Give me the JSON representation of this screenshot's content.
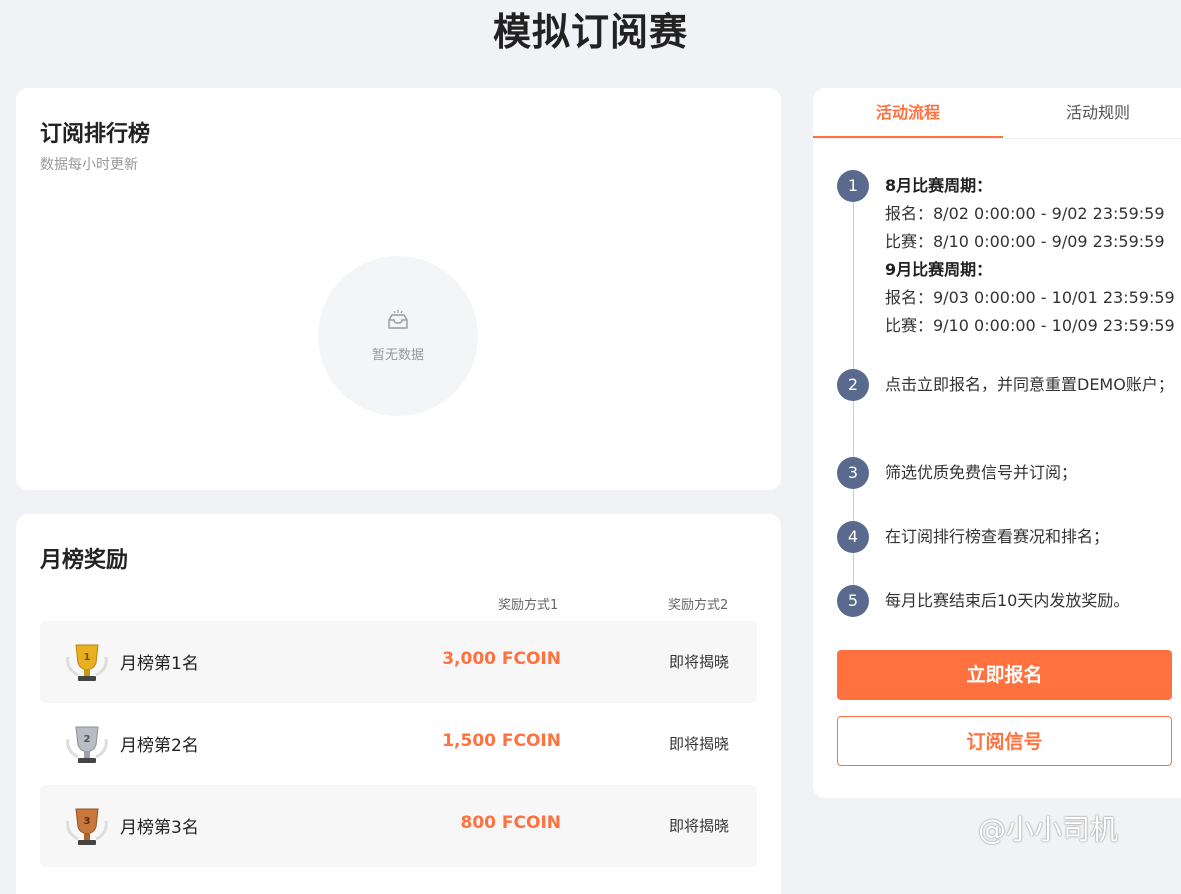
{
  "page": {
    "title": "模拟订阅赛"
  },
  "ranking": {
    "title": "订阅排行榜",
    "subtitle": "数据每小时更新",
    "empty_text": "暂无数据"
  },
  "rewards": {
    "title": "月榜奖励",
    "col1": "奖励方式1",
    "col2": "奖励方式2",
    "rows": [
      {
        "name": "月榜第1名",
        "amount": "3,000 FCOIN",
        "alt": "即将揭晓",
        "trophy_color": "#e8b020"
      },
      {
        "name": "月榜第2名",
        "amount": "1,500 FCOIN",
        "alt": "即将揭晓",
        "trophy_color": "#b8bcc4"
      },
      {
        "name": "月榜第3名",
        "amount": "800 FCOIN",
        "alt": "即将揭晓",
        "trophy_color": "#c8783c"
      }
    ]
  },
  "process": {
    "tabs": [
      "活动流程",
      "活动规则"
    ],
    "steps": [
      {
        "num": "1",
        "lines": [
          {
            "text": "8月比赛周期：",
            "bold": true
          },
          {
            "text": "报名：8/02 0:00:00 - 9/02 23:59:59",
            "bold": false
          },
          {
            "text": "比赛：8/10 0:00:00 - 9/09 23:59:59",
            "bold": false
          },
          {
            "text": "9月比赛周期：",
            "bold": true
          },
          {
            "text": "报名：9/03 0:00:00 - 10/01 23:59:59",
            "bold": false
          },
          {
            "text": "比赛：9/10 0:00:00 - 10/09 23:59:59",
            "bold": false
          }
        ]
      },
      {
        "num": "2",
        "lines": [
          {
            "text": "点击立即报名，并同意重置DEMO账户；",
            "bold": false
          }
        ]
      },
      {
        "num": "3",
        "lines": [
          {
            "text": "筛选优质免费信号并订阅；",
            "bold": false
          }
        ]
      },
      {
        "num": "4",
        "lines": [
          {
            "text": "在订阅排行榜查看赛况和排名；",
            "bold": false
          }
        ]
      },
      {
        "num": "5",
        "lines": [
          {
            "text": "每月比赛结束后10天内发放奖励。",
            "bold": false
          }
        ]
      }
    ],
    "signup_label": "立即报名",
    "subscribe_label": "订阅信号"
  },
  "watermark": "@小小司机",
  "colors": {
    "accent": "#ff7240",
    "step": "#5a6a8e"
  }
}
